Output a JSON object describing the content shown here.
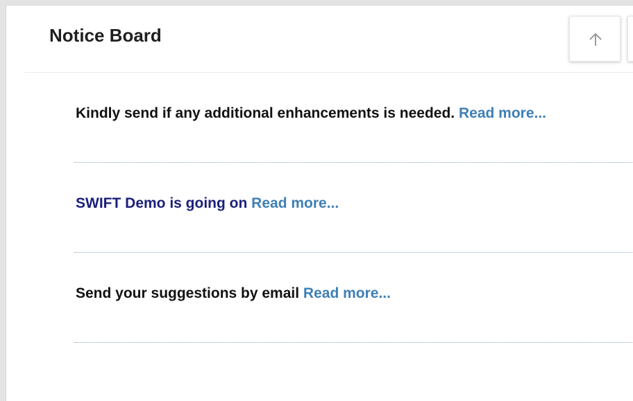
{
  "notice_board": {
    "title": "Notice Board",
    "buttons": {
      "up_icon": "arrow-up-icon",
      "next_icon": "next-button-icon"
    },
    "notices": [
      {
        "message": "Kindly send if any additional enhancements is needed.",
        "link": "Read more...",
        "color": "#111111"
      },
      {
        "message": "SWIFT Demo is going on",
        "link": "Read more...",
        "color": "#1b1f7a"
      },
      {
        "message": "Send your suggestions by email",
        "link": "Read more...",
        "color": "#111111"
      }
    ],
    "colors": {
      "link": "#3f7fb5",
      "divider": "#8fa3c4"
    }
  }
}
